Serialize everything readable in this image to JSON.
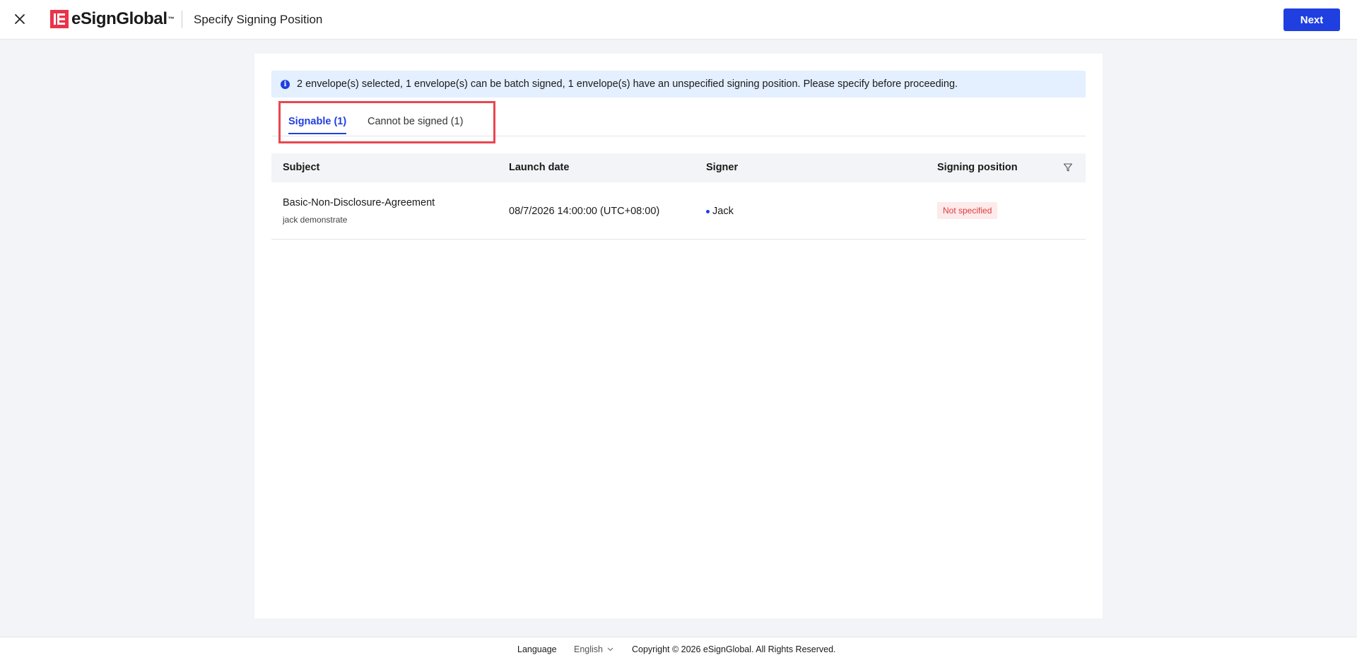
{
  "header": {
    "logo_text": "eSignGlobal",
    "logo_tm": "™",
    "title": "Specify Signing Position",
    "next_label": "Next"
  },
  "alert": {
    "icon": "info-icon",
    "text": "2 envelope(s) selected, 1 envelope(s) can be batch signed, 1 envelope(s) have an unspecified signing position. Please specify before proceeding."
  },
  "tabs": [
    {
      "label": "Signable (1)",
      "active": true
    },
    {
      "label": "Cannot be signed (1)",
      "active": false
    }
  ],
  "table": {
    "columns": [
      "Subject",
      "Launch date",
      "Signer",
      "Signing position"
    ],
    "rows": [
      {
        "subject": "Basic-Non-Disclosure-Agreement",
        "subject_sub": "jack demonstrate",
        "launch_date": "08/7/2026 14:00:00 (UTC+08:00)",
        "signer": "Jack",
        "signing_position": "Not specified"
      }
    ]
  },
  "footer": {
    "language_label": "Language",
    "language_value": "English",
    "copyright": "Copyright © 2026 eSignGlobal. All Rights Reserved."
  },
  "colors": {
    "accent": "#1f3fe0",
    "brand": "#e8344a",
    "status_red": "#e03a3a",
    "highlight": "#e8474f"
  }
}
